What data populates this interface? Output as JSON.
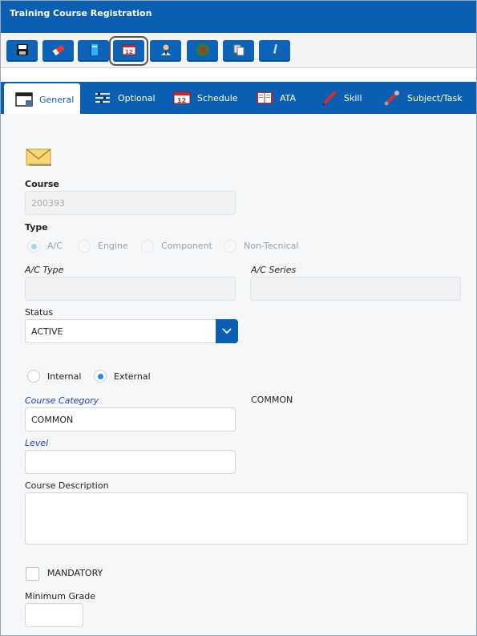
{
  "window": {
    "title": "Training Course Registration"
  },
  "toolbar": {
    "buttons": [
      {
        "name": "save-icon"
      },
      {
        "name": "eraser-icon"
      },
      {
        "name": "book-icon"
      },
      {
        "name": "schedule-icon"
      },
      {
        "name": "person-icon"
      },
      {
        "name": "cancel-icon"
      },
      {
        "name": "copy-icon"
      },
      {
        "name": "pen-icon"
      }
    ]
  },
  "tabs": [
    {
      "label": "General"
    },
    {
      "label": "Optional"
    },
    {
      "label": "Schedule"
    },
    {
      "label": "ATA"
    },
    {
      "label": "Skill"
    },
    {
      "label": "Subject/Task"
    }
  ],
  "form": {
    "course_label": "Course",
    "course_value": "200393",
    "type_label": "Type",
    "type_options": [
      "A/C",
      "Engine",
      "Component",
      "Non-Tecnical"
    ],
    "ac_type_label": "A/C Type",
    "ac_series_label": "A/C Series",
    "status_label": "Status",
    "status_value": "ACTIVE",
    "internal_label": "Internal",
    "external_label": "External",
    "course_category_label": "Course Category",
    "course_category_value": "COMMON",
    "course_category_display": "COMMON",
    "level_label": "Level",
    "level_value": "",
    "description_label": "Course Description",
    "mandatory_label": "MANDATORY",
    "minimum_grade_label": "Minimum Grade"
  },
  "colors": {
    "accent": "#0b5fb3",
    "link": "#1f3fc4",
    "radio_on": "#1a8fe0"
  }
}
